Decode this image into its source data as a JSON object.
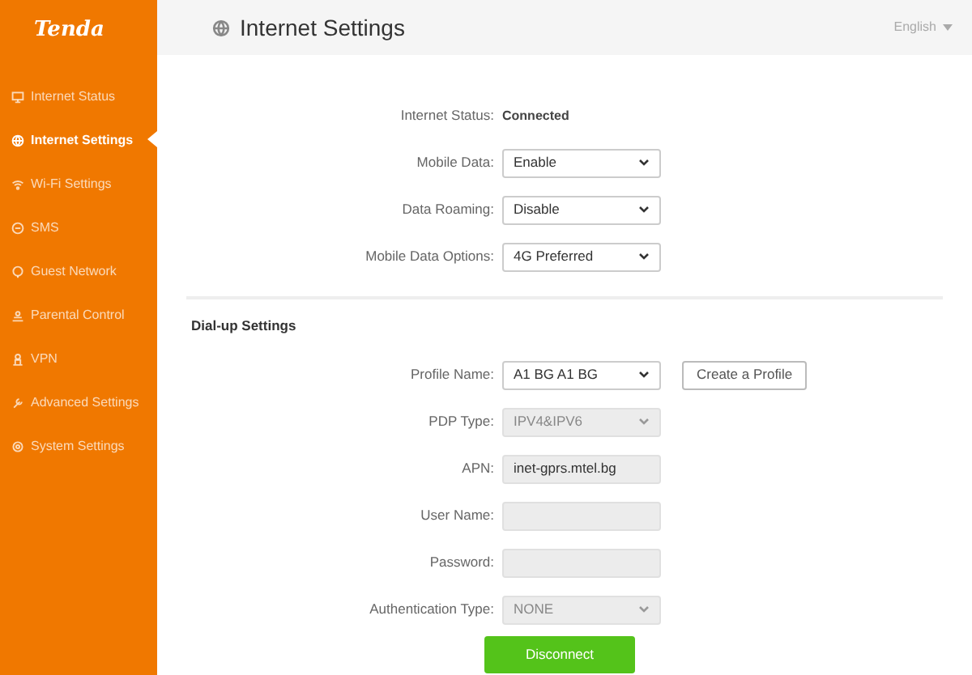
{
  "sidebar": {
    "logo": "Tenda",
    "items": [
      {
        "label": "Internet Status",
        "selected": false
      },
      {
        "label": "Internet Settings",
        "selected": true
      },
      {
        "label": "Wi-Fi Settings",
        "selected": false
      },
      {
        "label": "SMS",
        "selected": false
      },
      {
        "label": "Guest Network",
        "selected": false
      },
      {
        "label": "Parental Control",
        "selected": false
      },
      {
        "label": "VPN",
        "selected": false
      },
      {
        "label": "Advanced Settings",
        "selected": false
      },
      {
        "label": "System Settings",
        "selected": false
      }
    ]
  },
  "header": {
    "title": "Internet Settings",
    "language": "English"
  },
  "fields": [
    {
      "kind": "status",
      "label": "Internet Status:",
      "value": "Connected"
    },
    {
      "kind": "select",
      "label": "Mobile Data:",
      "value": "Enable",
      "disabled": false
    },
    {
      "kind": "select",
      "label": "Data Roaming:",
      "value": "Disable",
      "disabled": false
    },
    {
      "kind": "select",
      "label": "Mobile Data Options:",
      "value": "4G Preferred",
      "disabled": false
    }
  ],
  "dialup": {
    "title": "Dial-up Settings",
    "fields": [
      {
        "kind": "select",
        "label": "Profile Name:",
        "value": "A1 BG A1 BG",
        "disabled": false,
        "button": "Create a Profile"
      },
      {
        "kind": "select",
        "label": "PDP Type:",
        "value": "IPV4&IPV6",
        "disabled": true
      },
      {
        "kind": "text",
        "label": "APN:",
        "value": "inet-gprs.mtel.bg",
        "disabled": true
      },
      {
        "kind": "text",
        "label": "User Name:",
        "disabled": true
      },
      {
        "kind": "text",
        "label": "Password:",
        "disabled": true
      },
      {
        "kind": "select",
        "label": "Authentication Type:",
        "value": "NONE",
        "disabled": true
      }
    ],
    "button": "Disconnect"
  }
}
